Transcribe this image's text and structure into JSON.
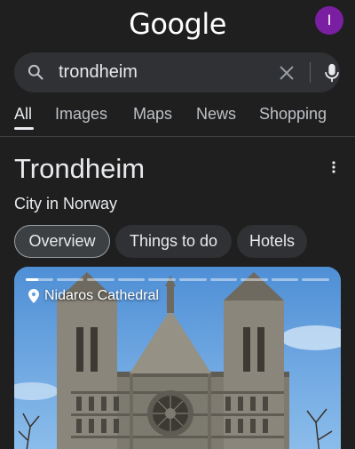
{
  "header": {
    "logo_text": "Google",
    "avatar_initial": "I",
    "avatar_color": "#7b1fa2"
  },
  "search": {
    "query": "trondheim"
  },
  "tabs": [
    {
      "label": "All",
      "active": true
    },
    {
      "label": "Images"
    },
    {
      "label": "Maps"
    },
    {
      "label": "News"
    },
    {
      "label": "Shopping"
    }
  ],
  "knowledge_panel": {
    "title": "Trondheim",
    "subtitle": "City in Norway",
    "chips": [
      {
        "label": "Overview",
        "selected": true
      },
      {
        "label": "Things to do"
      },
      {
        "label": "Hotels"
      }
    ],
    "photo": {
      "location_label": "Nidaros Cathedral",
      "story_segments": 10,
      "current_segment": 1,
      "current_segment_progress": 0.45
    }
  },
  "colors": {
    "background": "#1f1f1f",
    "surface": "#303134",
    "text": "#e8eaed",
    "muted": "#bdc1c6",
    "sky": "#6aa6e0",
    "stone": "#7d7a70"
  },
  "icons": [
    "search-icon",
    "close-icon",
    "mic-icon",
    "more-vert-icon",
    "location-pin-icon"
  ]
}
